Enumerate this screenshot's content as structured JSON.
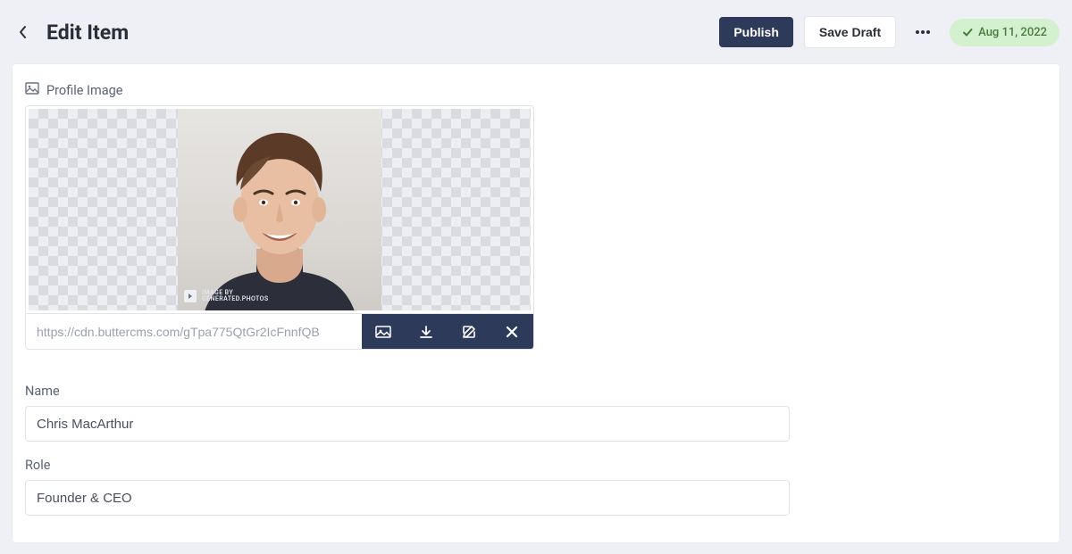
{
  "header": {
    "title": "Edit Item",
    "publish_label": "Publish",
    "save_draft_label": "Save Draft",
    "status_date": "Aug 11, 2022"
  },
  "fields": {
    "profile_image": {
      "label": "Profile Image",
      "url": "https://cdn.buttercms.com/gTpa775QtGr2IcFnnfQB",
      "watermark_line1": "IMAGE BY",
      "watermark_line2": "GENERATED.PHOTOS"
    },
    "name": {
      "label": "Name",
      "value": "Chris MacArthur"
    },
    "role": {
      "label": "Role",
      "value": "Founder & CEO"
    }
  },
  "icons": {
    "back": "chevron-left",
    "more": "ellipsis",
    "check": "check",
    "image": "image",
    "replace": "photo",
    "download": "download",
    "edit": "edit",
    "remove": "close"
  }
}
